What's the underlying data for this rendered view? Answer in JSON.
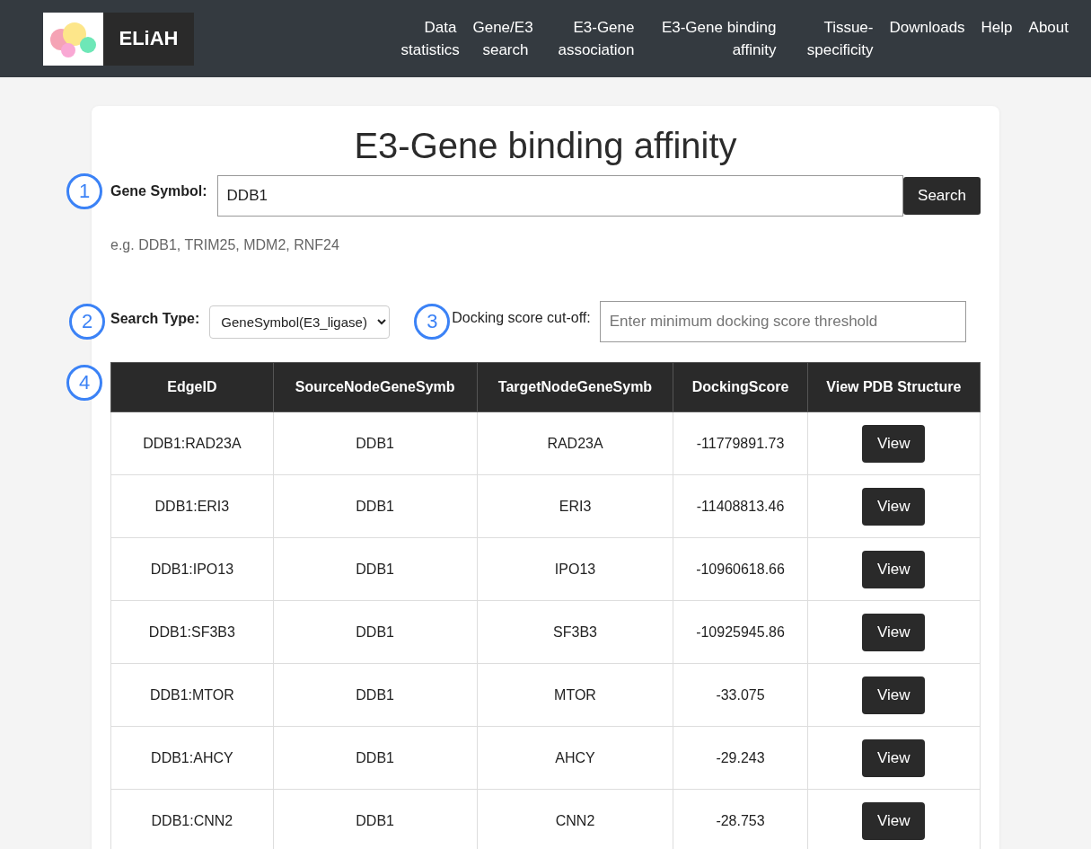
{
  "brand": {
    "name": "ELiAH"
  },
  "nav": [
    {
      "label": "Data statistics"
    },
    {
      "label": "Gene/E3 search"
    },
    {
      "label": "E3-Gene association"
    },
    {
      "label": "E3-Gene binding affinity"
    },
    {
      "label": "Tissue-specificity"
    },
    {
      "label": "Downloads"
    },
    {
      "label": "Help"
    },
    {
      "label": "About"
    }
  ],
  "page": {
    "title": "E3-Gene binding affinity"
  },
  "gene_search": {
    "marker": "1",
    "label": "Gene Symbol:",
    "value": "DDB1",
    "button": "Search",
    "hint": "e.g. DDB1, TRIM25, MDM2, RNF24"
  },
  "search_type": {
    "marker": "2",
    "label": "Search Type:",
    "value": "GeneSymbol(E3_ligase)"
  },
  "docking_cutoff": {
    "marker": "3",
    "label": "Docking score cut-off:",
    "placeholder": "Enter minimum docking score threshold"
  },
  "table": {
    "marker": "4",
    "columns": [
      "EdgeID",
      "SourceNodeGeneSymb",
      "TargetNodeGeneSymb",
      "DockingScore",
      "View PDB Structure"
    ],
    "rows": [
      {
        "edge": "DDB1:RAD23A",
        "source": "DDB1",
        "target": "RAD23A",
        "score": "-11779891.73",
        "action": "View"
      },
      {
        "edge": "DDB1:ERI3",
        "source": "DDB1",
        "target": "ERI3",
        "score": "-11408813.46",
        "action": "View"
      },
      {
        "edge": "DDB1:IPO13",
        "source": "DDB1",
        "target": "IPO13",
        "score": "-10960618.66",
        "action": "View"
      },
      {
        "edge": "DDB1:SF3B3",
        "source": "DDB1",
        "target": "SF3B3",
        "score": "-10925945.86",
        "action": "View"
      },
      {
        "edge": "DDB1:MTOR",
        "source": "DDB1",
        "target": "MTOR",
        "score": "-33.075",
        "action": "View"
      },
      {
        "edge": "DDB1:AHCY",
        "source": "DDB1",
        "target": "AHCY",
        "score": "-29.243",
        "action": "View"
      },
      {
        "edge": "DDB1:CNN2",
        "source": "DDB1",
        "target": "CNN2",
        "score": "-28.753",
        "action": "View"
      }
    ]
  }
}
